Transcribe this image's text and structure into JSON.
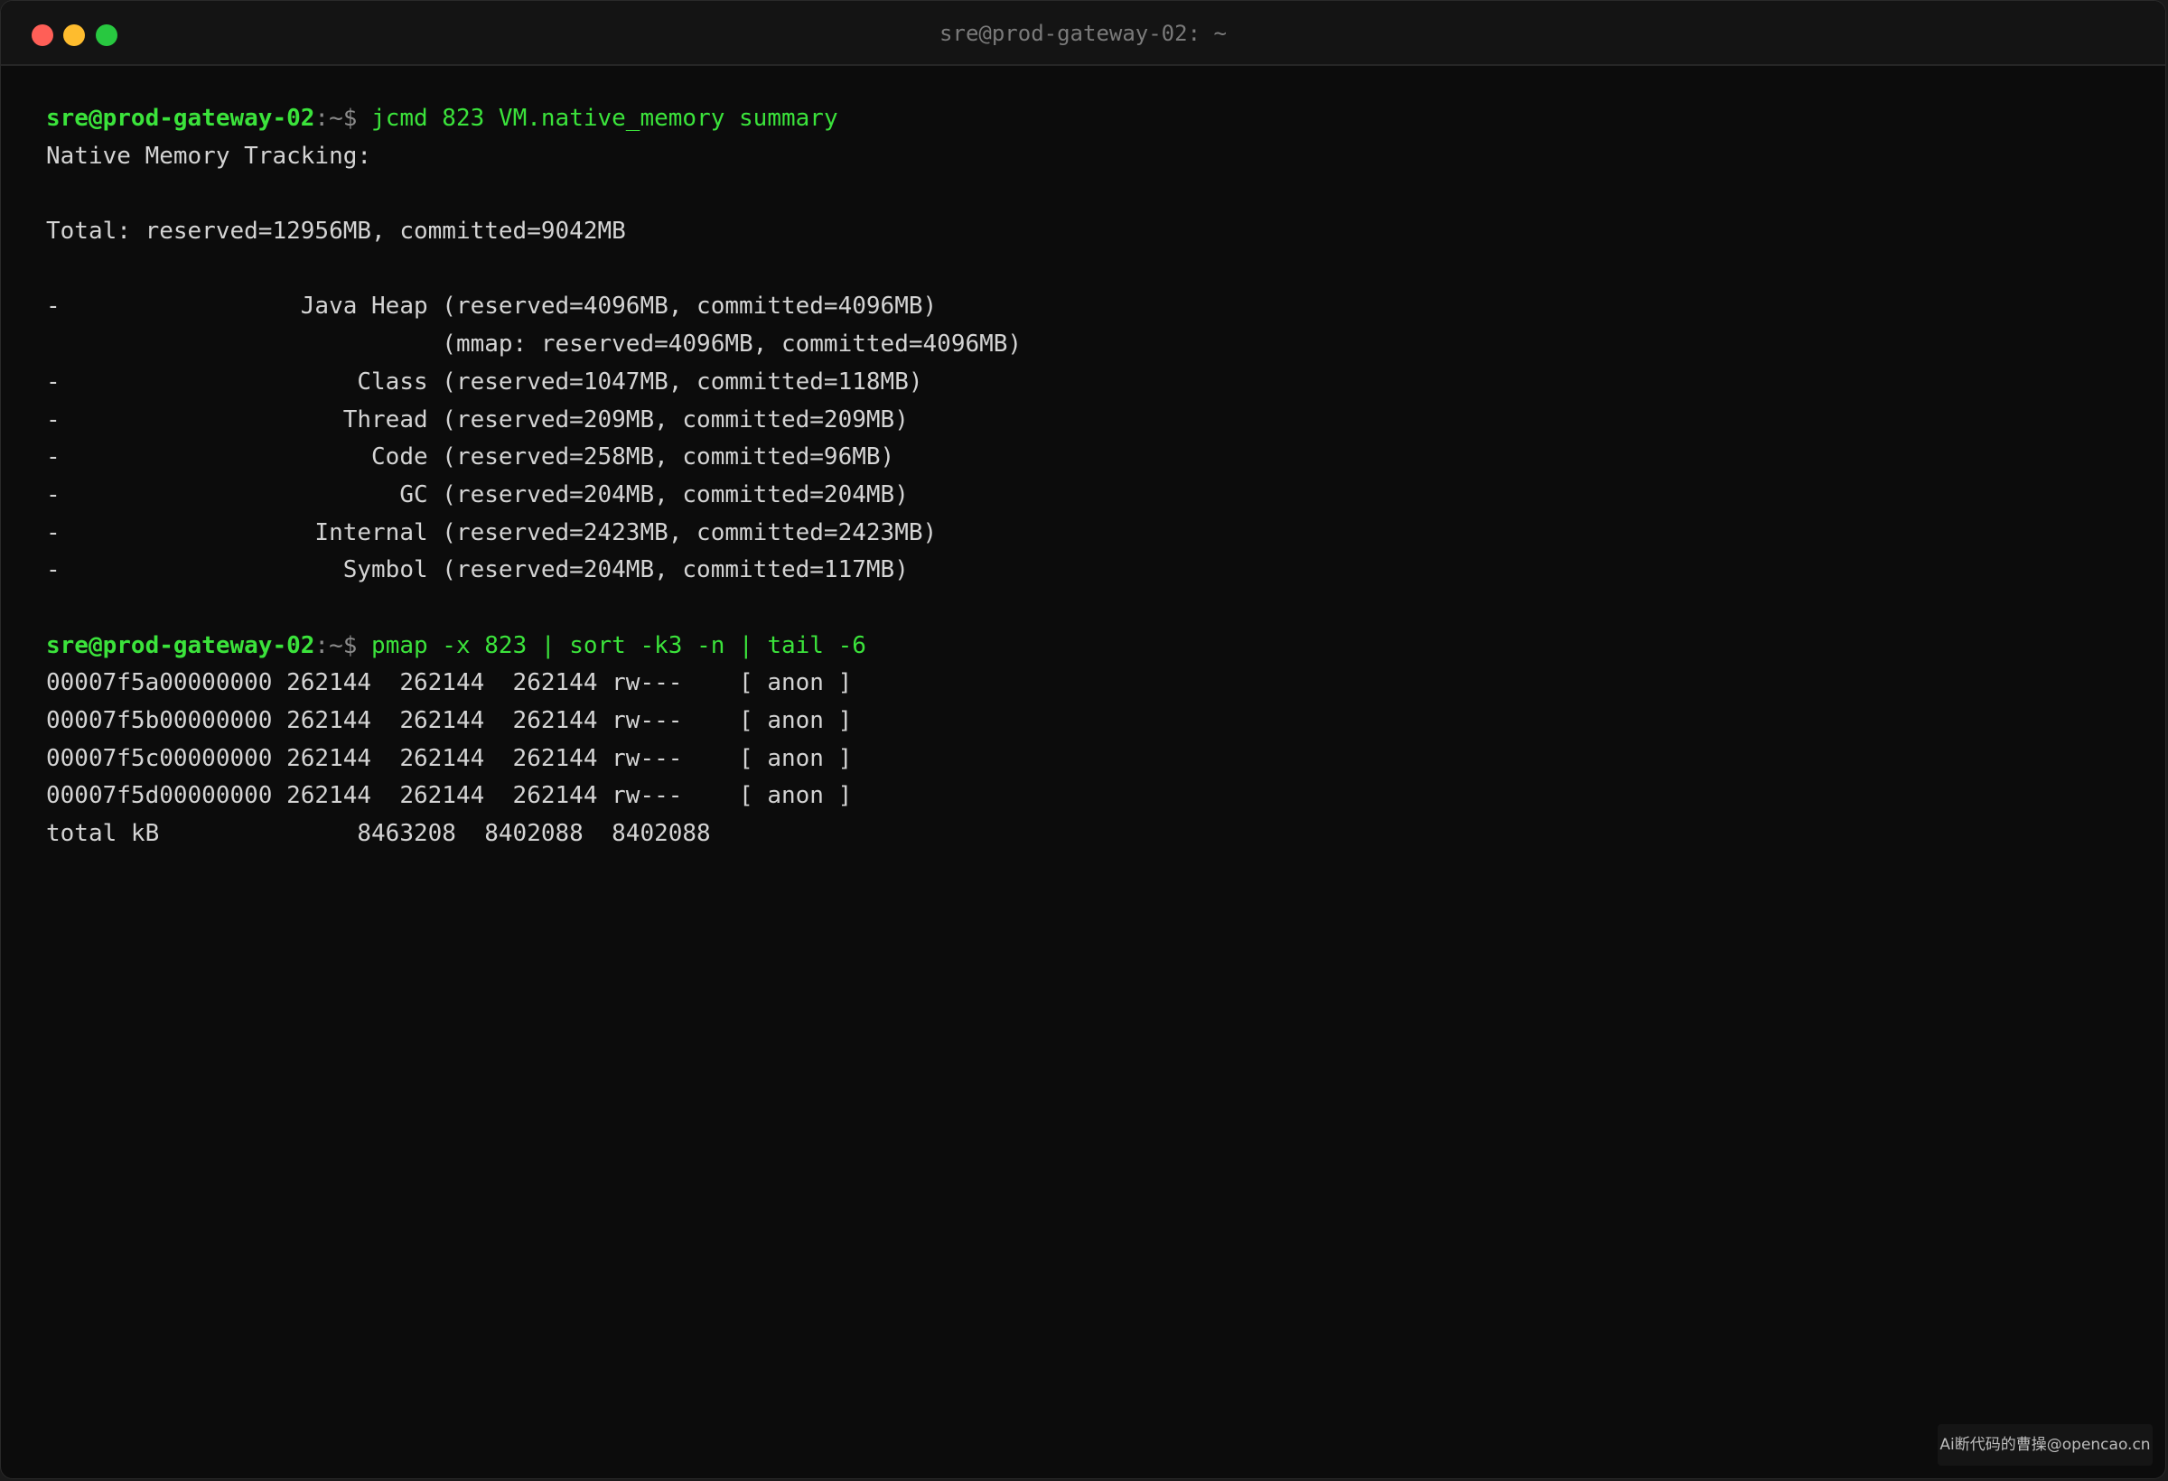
{
  "window": {
    "title": "sre@prod-gateway-02: ~",
    "buttons": {
      "close_color": "#ff5f57",
      "minimize_color": "#febc2e",
      "maximize_color": "#28c840"
    }
  },
  "terminal": {
    "lines": [
      {
        "type": "prompt",
        "user": "sre@prod-gateway-02",
        "path": ":~$",
        "cmd": "jcmd 823 VM.native_memory summary"
      },
      {
        "type": "output",
        "text": "Native Memory Tracking:"
      },
      {
        "type": "output",
        "text": ""
      },
      {
        "type": "output",
        "text": "Total: reserved=12956MB, committed=9042MB"
      },
      {
        "type": "output",
        "text": ""
      },
      {
        "type": "output",
        "text": "-                 Java Heap (reserved=4096MB, committed=4096MB)"
      },
      {
        "type": "output",
        "text": "                            (mmap: reserved=4096MB, committed=4096MB)"
      },
      {
        "type": "output",
        "text": "-                     Class (reserved=1047MB, committed=118MB)"
      },
      {
        "type": "output",
        "text": "-                    Thread (reserved=209MB, committed=209MB)"
      },
      {
        "type": "output",
        "text": "-                      Code (reserved=258MB, committed=96MB)"
      },
      {
        "type": "output",
        "text": "-                        GC (reserved=204MB, committed=204MB)"
      },
      {
        "type": "output",
        "text": "-                  Internal (reserved=2423MB, committed=2423MB)"
      },
      {
        "type": "output",
        "text": "-                    Symbol (reserved=204MB, committed=117MB)"
      },
      {
        "type": "output",
        "text": ""
      },
      {
        "type": "prompt",
        "user": "sre@prod-gateway-02",
        "path": ":~$",
        "cmd": "pmap -x 823 | sort -k3 -n | tail -6"
      },
      {
        "type": "output",
        "text": "00007f5a00000000 262144  262144  262144 rw---    [ anon ]"
      },
      {
        "type": "output",
        "text": "00007f5b00000000 262144  262144  262144 rw---    [ anon ]"
      },
      {
        "type": "output",
        "text": "00007f5c00000000 262144  262144  262144 rw---    [ anon ]"
      },
      {
        "type": "output",
        "text": "00007f5d00000000 262144  262144  262144 rw---    [ anon ]"
      },
      {
        "type": "output",
        "text": "total kB              8463208  8402088  8402088"
      }
    ]
  },
  "watermark": {
    "text": "Ai断代码的曹操@opencao.cn"
  },
  "colors": {
    "background": "#0c0c0c",
    "prompt_green": "#3be33b",
    "output_text": "#d4d4d4",
    "title_text": "#7a7a7a"
  }
}
